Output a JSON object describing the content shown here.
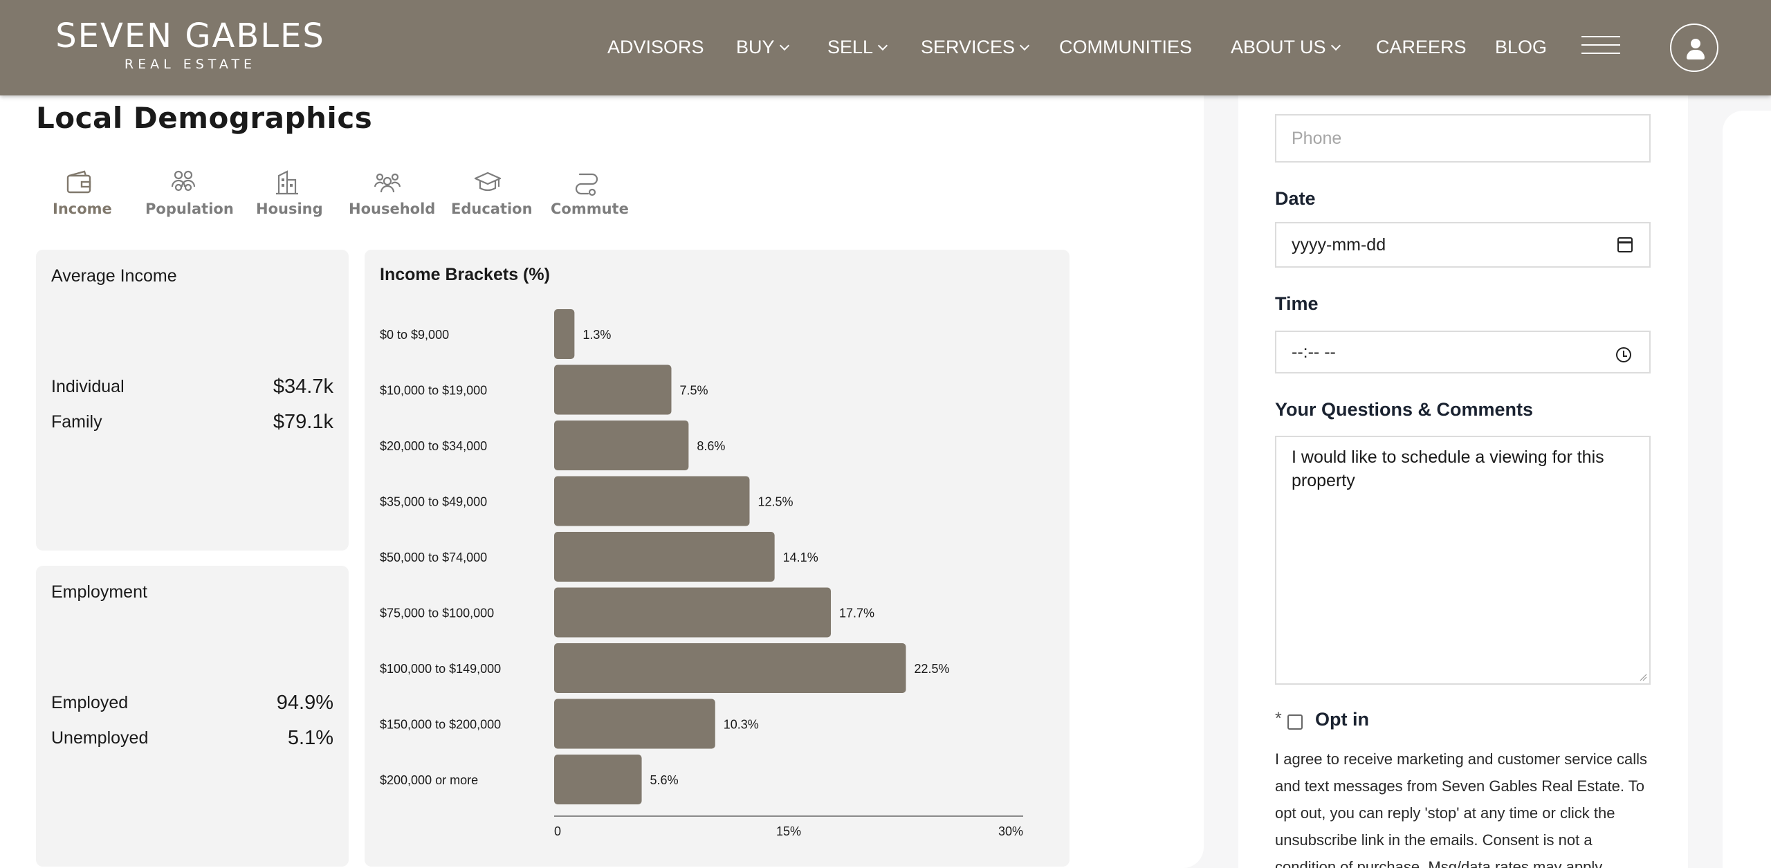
{
  "header": {
    "logo_main": "SEVEN GABLES",
    "logo_sub": "REAL ESTATE",
    "nav": [
      {
        "label": "ADVISORS",
        "dropdown": false
      },
      {
        "label": "BUY",
        "dropdown": true
      },
      {
        "label": "SELL",
        "dropdown": true
      },
      {
        "label": "SERVICES",
        "dropdown": true
      },
      {
        "label": "COMMUNITIES",
        "dropdown": false
      },
      {
        "label": "ABOUT US",
        "dropdown": true
      },
      {
        "label": "CAREERS",
        "dropdown": false
      },
      {
        "label": "BLOG",
        "dropdown": false
      }
    ],
    "menu_icon": "hamburger-icon",
    "account_icon": "user-icon",
    "color": "#80786c"
  },
  "demographics": {
    "title": "Local Demographics",
    "tabs": [
      {
        "label": "Income",
        "icon": "wallet-icon",
        "active": true
      },
      {
        "label": "Population",
        "icon": "people-icon",
        "active": false
      },
      {
        "label": "Housing",
        "icon": "building-icon",
        "active": false
      },
      {
        "label": "Household",
        "icon": "family-icon",
        "active": false
      },
      {
        "label": "Education",
        "icon": "graduation-cap-icon",
        "active": false
      },
      {
        "label": "Commute",
        "icon": "route-icon",
        "active": false
      }
    ],
    "average_income": {
      "title": "Average Income",
      "rows": [
        {
          "label": "Individual",
          "value": "$34.7k"
        },
        {
          "label": "Family",
          "value": "$79.1k"
        }
      ]
    },
    "employment": {
      "title": "Employment",
      "rows": [
        {
          "label": "Employed",
          "value": "94.9%"
        },
        {
          "label": "Unemployed",
          "value": "5.1%"
        }
      ]
    }
  },
  "chart_data": {
    "type": "bar",
    "orientation": "horizontal",
    "title": "Income Brackets (%)",
    "categories": [
      "$0 to $9,000",
      "$10,000 to $19,000",
      "$20,000 to $34,000",
      "$35,000 to $49,000",
      "$50,000 to $74,000",
      "$75,000 to $100,000",
      "$100,000 to $149,000",
      "$150,000 to $200,000",
      "$200,000 or more"
    ],
    "values": [
      1.3,
      7.5,
      8.6,
      12.5,
      14.1,
      17.7,
      22.5,
      10.3,
      5.6
    ],
    "value_labels": [
      "1.3%",
      "7.5%",
      "8.6%",
      "12.5%",
      "14.1%",
      "17.7%",
      "22.5%",
      "10.3%",
      "5.6%"
    ],
    "xlim": [
      0,
      30
    ],
    "xticks": [
      "0",
      "15%",
      "30%"
    ],
    "xtick_values": [
      0,
      15,
      30
    ],
    "bar_color": "#80786c",
    "grid": false
  },
  "form": {
    "phone_placeholder": "Phone",
    "date_label": "Date",
    "date_value": "yyyy-mm-dd",
    "time_label": "Time",
    "time_value": "--:-- --",
    "comments_label": "Your Questions & Comments",
    "comments_value": "I would like to schedule a viewing for this property",
    "optin_asterisk": "*",
    "optin_label": "Opt in",
    "consent_text": "I agree to receive marketing and customer service calls and text messages from Seven Gables Real Estate. To opt out, you can reply 'stop' at any time or click the unsubscribe link in the emails. Consent is not a condition of purchase. Msg/data rates may apply."
  }
}
